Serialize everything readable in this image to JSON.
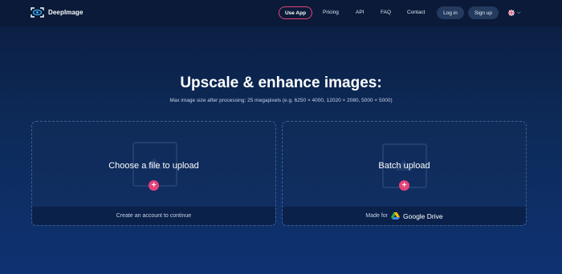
{
  "nav": {
    "brand": "DeepImage",
    "use_app": "Use App",
    "links": [
      "Pricing",
      "API",
      "FAQ",
      "Contact"
    ],
    "login": "Log in",
    "signup": "Sign up",
    "language_icon": "uk-flag-icon"
  },
  "hero": {
    "title": "Upscale & enhance images:",
    "subtitle": "Max image size after processing: 25 megapixels (e.g. 6250 × 4000, 12020 × 2080, 5000 × 5000)"
  },
  "upload_single": {
    "title": "Choose a file to upload",
    "footer": "Create an account to continue"
  },
  "upload_batch": {
    "title": "Batch upload",
    "footer_prefix": "Made for",
    "footer_brand": "Google Drive"
  },
  "colors": {
    "accent": "#e5437a",
    "background_top": "#0b1d3f",
    "background_bottom": "#0e3272"
  }
}
